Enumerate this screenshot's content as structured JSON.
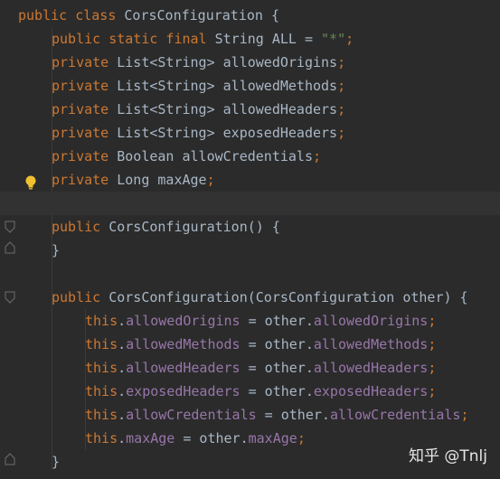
{
  "editor": {
    "lines": [
      {
        "tokens": [
          {
            "t": "public class ",
            "c": "kw"
          },
          {
            "t": "CorsConfiguration {",
            "c": ""
          }
        ]
      },
      {
        "tokens": [
          {
            "t": "public static final ",
            "c": "kw"
          },
          {
            "t": "String ALL = ",
            "c": ""
          },
          {
            "t": "\"*\"",
            "c": "str"
          },
          {
            "t": ";",
            "c": "semi"
          }
        ]
      },
      {
        "tokens": [
          {
            "t": "private ",
            "c": "kw"
          },
          {
            "t": "List<String> allowedOrigins",
            "c": ""
          },
          {
            "t": ";",
            "c": "semi"
          }
        ]
      },
      {
        "tokens": [
          {
            "t": "private ",
            "c": "kw"
          },
          {
            "t": "List<String> allowedMethods",
            "c": ""
          },
          {
            "t": ";",
            "c": "semi"
          }
        ]
      },
      {
        "tokens": [
          {
            "t": "private ",
            "c": "kw"
          },
          {
            "t": "List<String> allowedHeaders",
            "c": ""
          },
          {
            "t": ";",
            "c": "semi"
          }
        ]
      },
      {
        "tokens": [
          {
            "t": "private ",
            "c": "kw"
          },
          {
            "t": "List<String> exposedHeaders",
            "c": ""
          },
          {
            "t": ";",
            "c": "semi"
          }
        ]
      },
      {
        "tokens": [
          {
            "t": "private ",
            "c": "kw"
          },
          {
            "t": "Boolean allowCredentials",
            "c": ""
          },
          {
            "t": ";",
            "c": "semi"
          }
        ]
      },
      {
        "tokens": [
          {
            "t": "private ",
            "c": "kw"
          },
          {
            "t": "Long maxAge",
            "c": ""
          },
          {
            "t": ";",
            "c": "semi"
          }
        ]
      },
      {
        "tokens": []
      },
      {
        "tokens": [
          {
            "t": "public ",
            "c": "kw"
          },
          {
            "t": "CorsConfiguration() {",
            "c": ""
          }
        ]
      },
      {
        "tokens": [
          {
            "t": "}",
            "c": ""
          }
        ]
      },
      {
        "tokens": []
      },
      {
        "tokens": [
          {
            "t": "public ",
            "c": "kw"
          },
          {
            "t": "CorsConfiguration(CorsConfiguration other) {",
            "c": ""
          }
        ]
      },
      {
        "tokens": [
          {
            "t": "this",
            "c": "kw"
          },
          {
            "t": ".",
            "c": ""
          },
          {
            "t": "allowedOrigins",
            "c": "fld"
          },
          {
            "t": " = other.",
            "c": ""
          },
          {
            "t": "allowedOrigins",
            "c": "fld"
          },
          {
            "t": ";",
            "c": "semi"
          }
        ]
      },
      {
        "tokens": [
          {
            "t": "this",
            "c": "kw"
          },
          {
            "t": ".",
            "c": ""
          },
          {
            "t": "allowedMethods",
            "c": "fld"
          },
          {
            "t": " = other.",
            "c": ""
          },
          {
            "t": "allowedMethods",
            "c": "fld"
          },
          {
            "t": ";",
            "c": "semi"
          }
        ]
      },
      {
        "tokens": [
          {
            "t": "this",
            "c": "kw"
          },
          {
            "t": ".",
            "c": ""
          },
          {
            "t": "allowedHeaders",
            "c": "fld"
          },
          {
            "t": " = other.",
            "c": ""
          },
          {
            "t": "allowedHeaders",
            "c": "fld"
          },
          {
            "t": ";",
            "c": "semi"
          }
        ]
      },
      {
        "tokens": [
          {
            "t": "this",
            "c": "kw"
          },
          {
            "t": ".",
            "c": ""
          },
          {
            "t": "exposedHeaders",
            "c": "fld"
          },
          {
            "t": " = other.",
            "c": ""
          },
          {
            "t": "exposedHeaders",
            "c": "fld"
          },
          {
            "t": ";",
            "c": "semi"
          }
        ]
      },
      {
        "tokens": [
          {
            "t": "this",
            "c": "kw"
          },
          {
            "t": ".",
            "c": ""
          },
          {
            "t": "allowCredentials",
            "c": "fld"
          },
          {
            "t": " = other.",
            "c": ""
          },
          {
            "t": "allowCredentials",
            "c": "fld"
          },
          {
            "t": ";",
            "c": "semi"
          }
        ]
      },
      {
        "tokens": [
          {
            "t": "this",
            "c": "kw"
          },
          {
            "t": ".",
            "c": ""
          },
          {
            "t": "maxAge",
            "c": "fld"
          },
          {
            "t": " = other.",
            "c": ""
          },
          {
            "t": "maxAge",
            "c": "fld"
          },
          {
            "t": ";",
            "c": "semi"
          }
        ]
      },
      {
        "tokens": [
          {
            "t": "}",
            "c": ""
          }
        ]
      }
    ]
  },
  "watermark": {
    "text": "知乎 @Tnlj"
  },
  "colors": {
    "background": "#2b2b2b",
    "keyword": "#cc7832",
    "string": "#6a8759",
    "field": "#9876aa",
    "text": "#a9b7c6",
    "bulb": "#f0c030"
  },
  "icons": [
    "intention-bulb-icon",
    "fold-marker-icon"
  ]
}
